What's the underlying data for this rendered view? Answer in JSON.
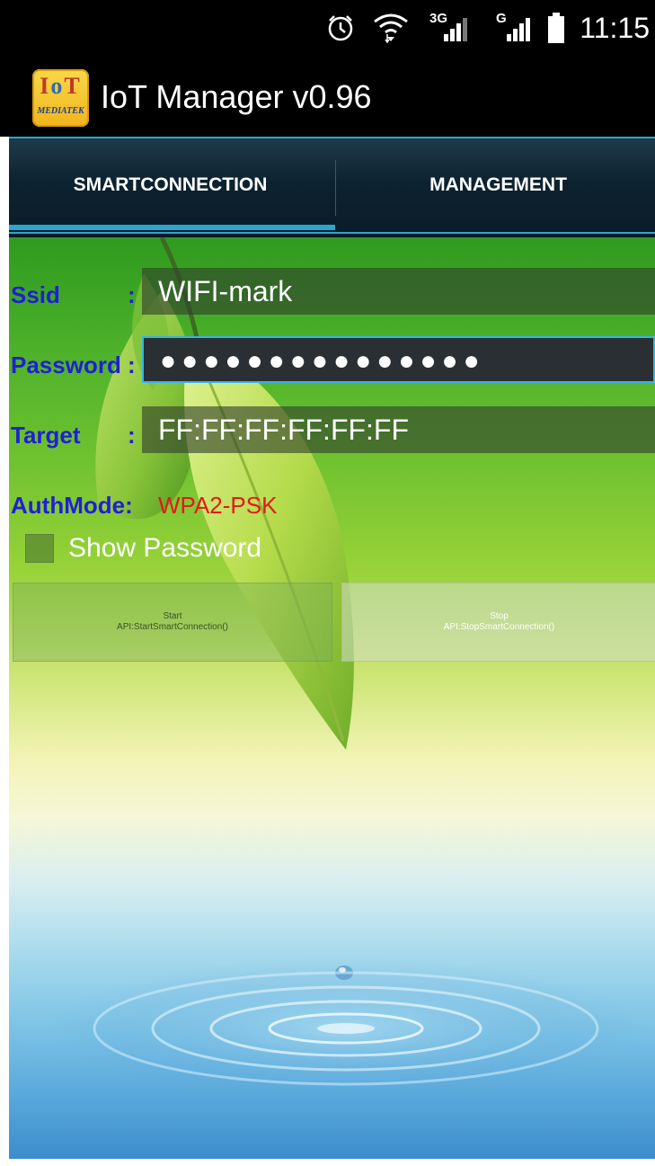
{
  "status_bar": {
    "time": "11:15",
    "net1": "3G",
    "net2": "G",
    "icons": [
      "alarm-icon",
      "wifi-icon",
      "signal-icon",
      "signal-icon",
      "battery-icon"
    ]
  },
  "app": {
    "title": "IoT Manager v0.96",
    "logo": {
      "letters": [
        "I",
        "o",
        "T"
      ],
      "sub": "MEDIATEK"
    }
  },
  "tabs": [
    {
      "label": "SMARTCONNECTION",
      "selected": true
    },
    {
      "label": "MANAGEMENT",
      "selected": false
    }
  ],
  "form": {
    "ssid": {
      "label": "Ssid",
      "colon": ":",
      "value": "WIFI-mark"
    },
    "password": {
      "label": "Password",
      "colon": ":",
      "value": "●●●●●●●●●●●●●●●"
    },
    "target": {
      "label": "Target",
      "colon": ":",
      "value": "FF:FF:FF:FF:FF:FF"
    },
    "authmode": {
      "label": "AuthMode:",
      "value": "WPA2-PSK"
    },
    "show_password": {
      "label": "Show Password",
      "checked": false
    }
  },
  "buttons": {
    "start": {
      "line1": "Start",
      "line2": "API:StartSmartConnection()"
    },
    "stop": {
      "line1": "Stop",
      "line2": "API:StopSmartConnection()"
    }
  },
  "colors": {
    "accent": "#2ba6cf",
    "label_blue": "#1f1fd6",
    "auth_red": "#e21a1a"
  }
}
